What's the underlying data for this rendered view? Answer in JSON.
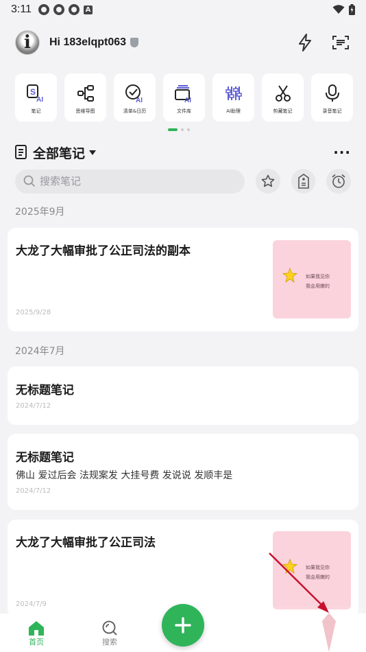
{
  "status_bar": {
    "time": "3:11",
    "app_badge": "A"
  },
  "header": {
    "greeting": "Hi 183elqpt063"
  },
  "tools": [
    {
      "label": "笔记",
      "icon": "ai-note-icon"
    },
    {
      "label": "思维导图",
      "icon": "mindmap-icon"
    },
    {
      "label": "清单&日历",
      "icon": "checklist-ai-icon"
    },
    {
      "label": "文件库",
      "icon": "file-library-ai-icon"
    },
    {
      "label": "AI助理",
      "icon": "ai-assistant-icon"
    },
    {
      "label": "剪藏笔记",
      "icon": "scissors-icon"
    },
    {
      "label": "录音笔记",
      "icon": "microphone-icon"
    }
  ],
  "section": {
    "title": "全部笔记",
    "more": "···"
  },
  "search": {
    "placeholder": "搜索笔记"
  },
  "groups": [
    {
      "date_label": "2025年9月"
    },
    {
      "date_label": "2024年7月"
    }
  ],
  "notes": [
    {
      "title": "大龙了大幅审批了公正司法的副本",
      "body": "",
      "date": "2025/9/28",
      "thumb_text_1": "如果我见你",
      "thumb_text_2": "我会用嫩的"
    },
    {
      "title": "无标题笔记",
      "body": "",
      "date": "2024/7/12"
    },
    {
      "title": "无标题笔记",
      "body": "佛山 爱过后会 法规案发 大挂号费 发说说 发顺丰是",
      "date": "2024/7/12"
    },
    {
      "title": "大龙了大幅审批了公正司法",
      "body": "",
      "date": "2024/7/9",
      "thumb_text_1": "如果我见你",
      "thumb_text_2": "我会用嫩的"
    }
  ],
  "bottom_nav": {
    "home": "首页",
    "search": "搜索",
    "fab": "+"
  },
  "colors": {
    "accent": "#2fb45a",
    "thumb_bg": "#fbd3dc",
    "annotation": "#c8102e"
  }
}
